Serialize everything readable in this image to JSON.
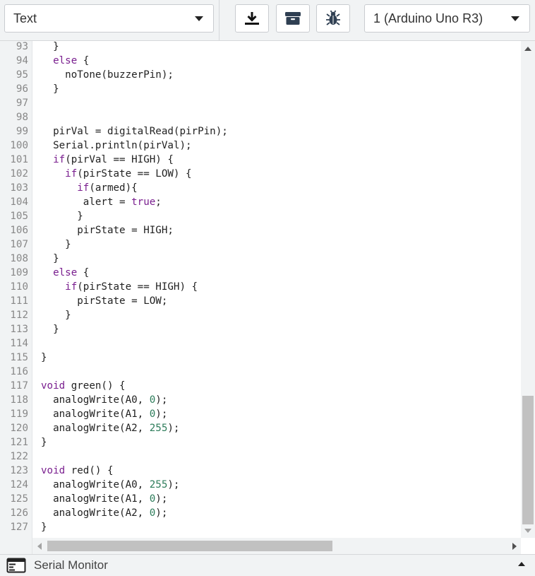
{
  "toolbar": {
    "mode": "Text",
    "board": "1 (Arduino Uno R3)",
    "buttons": [
      "download-icon",
      "libraries-icon",
      "debugger-icon"
    ]
  },
  "editor": {
    "lines": [
      {
        "n": "93",
        "segs": [
          {
            "t": "  }"
          }
        ]
      },
      {
        "n": "94",
        "segs": [
          {
            "t": "  "
          },
          {
            "t": "else",
            "c": "kw"
          },
          {
            "t": " {"
          }
        ]
      },
      {
        "n": "95",
        "segs": [
          {
            "t": "    noTone(buzzerPin);"
          }
        ]
      },
      {
        "n": "96",
        "segs": [
          {
            "t": "  }"
          }
        ]
      },
      {
        "n": "97",
        "segs": [
          {
            "t": ""
          }
        ]
      },
      {
        "n": "98",
        "segs": [
          {
            "t": ""
          }
        ]
      },
      {
        "n": "99",
        "segs": [
          {
            "t": "  pirVal = digitalRead(pirPin);"
          }
        ]
      },
      {
        "n": "100",
        "segs": [
          {
            "t": "  Serial.println(pirVal);"
          }
        ]
      },
      {
        "n": "101",
        "segs": [
          {
            "t": "  "
          },
          {
            "t": "if",
            "c": "kw"
          },
          {
            "t": "(pirVal == HIGH) {"
          }
        ]
      },
      {
        "n": "102",
        "segs": [
          {
            "t": "    "
          },
          {
            "t": "if",
            "c": "kw"
          },
          {
            "t": "(pirState == LOW) {"
          }
        ]
      },
      {
        "n": "103",
        "segs": [
          {
            "t": "      "
          },
          {
            "t": "if",
            "c": "kw"
          },
          {
            "t": "(armed){"
          }
        ]
      },
      {
        "n": "104",
        "segs": [
          {
            "t": "       alert = "
          },
          {
            "t": "true",
            "c": "kw"
          },
          {
            "t": ";"
          }
        ]
      },
      {
        "n": "105",
        "segs": [
          {
            "t": "      }"
          }
        ]
      },
      {
        "n": "106",
        "segs": [
          {
            "t": "      pirState = HIGH;"
          }
        ]
      },
      {
        "n": "107",
        "segs": [
          {
            "t": "    }"
          }
        ]
      },
      {
        "n": "108",
        "segs": [
          {
            "t": "  }"
          }
        ]
      },
      {
        "n": "109",
        "segs": [
          {
            "t": "  "
          },
          {
            "t": "else",
            "c": "kw"
          },
          {
            "t": " {"
          }
        ]
      },
      {
        "n": "110",
        "segs": [
          {
            "t": "    "
          },
          {
            "t": "if",
            "c": "kw"
          },
          {
            "t": "(pirState == HIGH) {"
          }
        ]
      },
      {
        "n": "111",
        "segs": [
          {
            "t": "      pirState = LOW;"
          }
        ]
      },
      {
        "n": "112",
        "segs": [
          {
            "t": "    }"
          }
        ]
      },
      {
        "n": "113",
        "segs": [
          {
            "t": "  }"
          }
        ]
      },
      {
        "n": "114",
        "segs": [
          {
            "t": ""
          }
        ]
      },
      {
        "n": "115",
        "segs": [
          {
            "t": "}"
          }
        ]
      },
      {
        "n": "116",
        "segs": [
          {
            "t": ""
          }
        ]
      },
      {
        "n": "117",
        "segs": [
          {
            "t": "void",
            "c": "kw"
          },
          {
            "t": " green() {"
          }
        ]
      },
      {
        "n": "118",
        "segs": [
          {
            "t": "  analogWrite(A0, "
          },
          {
            "t": "0",
            "c": "num"
          },
          {
            "t": ");"
          }
        ]
      },
      {
        "n": "119",
        "segs": [
          {
            "t": "  analogWrite(A1, "
          },
          {
            "t": "0",
            "c": "num"
          },
          {
            "t": ");"
          }
        ]
      },
      {
        "n": "120",
        "segs": [
          {
            "t": "  analogWrite(A2, "
          },
          {
            "t": "255",
            "c": "num"
          },
          {
            "t": ");"
          }
        ]
      },
      {
        "n": "121",
        "segs": [
          {
            "t": "}"
          }
        ]
      },
      {
        "n": "122",
        "segs": [
          {
            "t": ""
          }
        ]
      },
      {
        "n": "123",
        "segs": [
          {
            "t": "void",
            "c": "kw"
          },
          {
            "t": " red() {"
          }
        ]
      },
      {
        "n": "124",
        "segs": [
          {
            "t": "  analogWrite(A0, "
          },
          {
            "t": "255",
            "c": "num"
          },
          {
            "t": ");"
          }
        ]
      },
      {
        "n": "125",
        "segs": [
          {
            "t": "  analogWrite(A1, "
          },
          {
            "t": "0",
            "c": "num"
          },
          {
            "t": ");"
          }
        ]
      },
      {
        "n": "126",
        "segs": [
          {
            "t": "  analogWrite(A2, "
          },
          {
            "t": "0",
            "c": "num"
          },
          {
            "t": ");"
          }
        ]
      },
      {
        "n": "127",
        "segs": [
          {
            "t": "}"
          }
        ]
      }
    ]
  },
  "serial": {
    "label": "Serial Monitor"
  },
  "colors": {
    "keyword": "#7a1f8f",
    "number": "#2e7d5b",
    "chrome": "#f1f3f4"
  }
}
